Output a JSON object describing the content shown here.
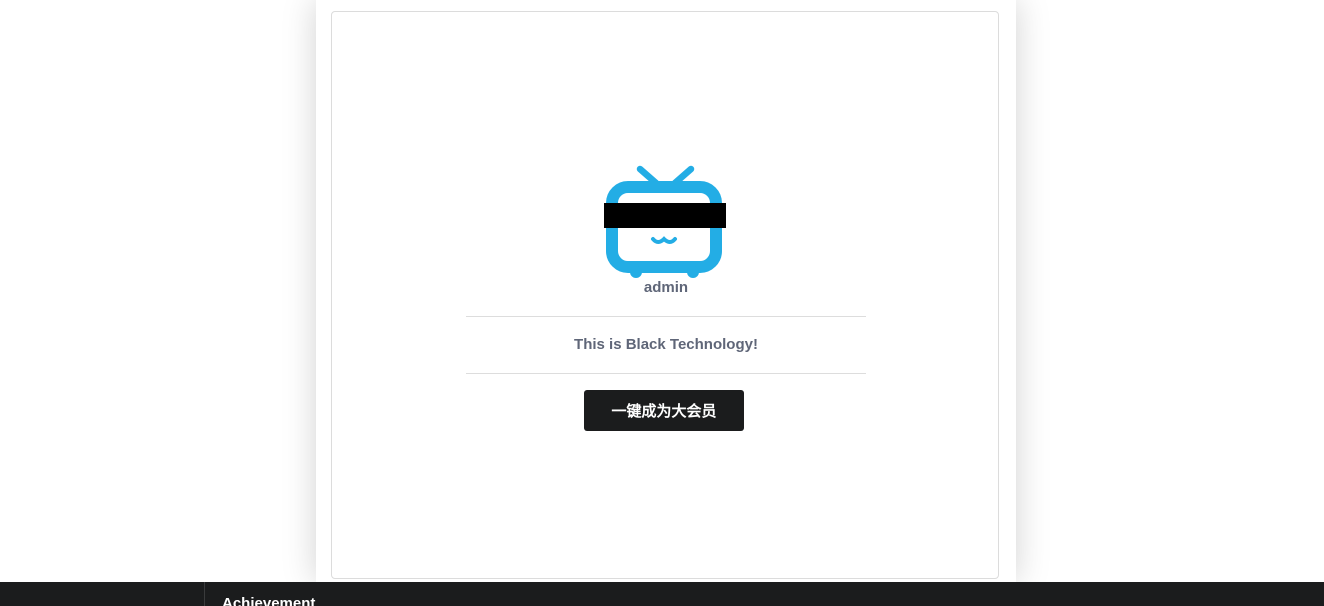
{
  "card": {
    "username": "admin",
    "tagline": "This is Black Technology!",
    "button_label": "一键成为大会员"
  },
  "avatar": {
    "icon": "bilibili-tv-icon",
    "color": "#23ade5",
    "censor_bar_color": "#000000"
  },
  "footer": {
    "heading": "Achievement"
  },
  "colors": {
    "button_bg": "#1b1c1d",
    "text": "#5f6678",
    "footer_bg": "#1b1c1d"
  }
}
